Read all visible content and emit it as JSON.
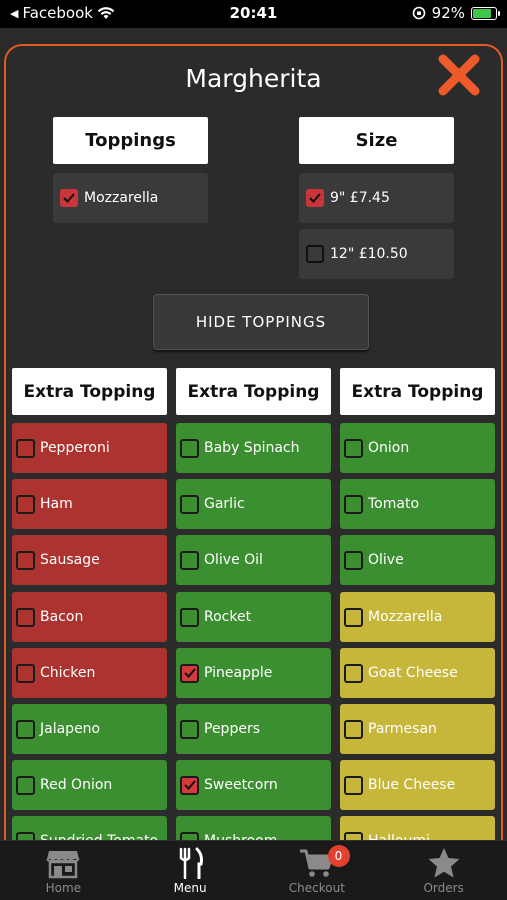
{
  "status_bar": {
    "back_app": "Facebook",
    "time": "20:41",
    "battery": "92%"
  },
  "modal": {
    "title": "Margherita",
    "toppings_header": "Toppings",
    "size_header": "Size",
    "base_toppings": [
      {
        "label": "Mozzarella",
        "checked": true
      }
    ],
    "sizes": [
      {
        "label": "9\" £7.45",
        "checked": true
      },
      {
        "label": "12\" £10.50",
        "checked": false
      }
    ],
    "hide_toppings_label": "HIDE TOPPINGS",
    "extra_header": "Extra Topping",
    "columns": [
      [
        {
          "label": "Pepperoni",
          "color": "red",
          "checked": false
        },
        {
          "label": "Ham",
          "color": "red",
          "checked": false
        },
        {
          "label": "Sausage",
          "color": "red",
          "checked": false
        },
        {
          "label": "Bacon",
          "color": "red",
          "checked": false
        },
        {
          "label": "Chicken",
          "color": "red",
          "checked": false
        },
        {
          "label": "Jalapeno",
          "color": "green",
          "checked": false
        },
        {
          "label": "Red Onion",
          "color": "green",
          "checked": false
        },
        {
          "label": "Sundried Tomato",
          "color": "green",
          "checked": false
        }
      ],
      [
        {
          "label": "Baby Spinach",
          "color": "green",
          "checked": false
        },
        {
          "label": "Garlic",
          "color": "green",
          "checked": false
        },
        {
          "label": "Olive Oil",
          "color": "green",
          "checked": false
        },
        {
          "label": "Rocket",
          "color": "green",
          "checked": false
        },
        {
          "label": "Pineapple",
          "color": "green",
          "checked": true
        },
        {
          "label": "Peppers",
          "color": "green",
          "checked": false
        },
        {
          "label": "Sweetcorn",
          "color": "green",
          "checked": true
        },
        {
          "label": "Mushroom",
          "color": "green",
          "checked": false
        }
      ],
      [
        {
          "label": "Onion",
          "color": "green",
          "checked": false
        },
        {
          "label": "Tomato",
          "color": "green",
          "checked": false
        },
        {
          "label": "Olive",
          "color": "green",
          "checked": false
        },
        {
          "label": "Mozzarella",
          "color": "yellow",
          "checked": false
        },
        {
          "label": "Goat Cheese",
          "color": "yellow",
          "checked": false
        },
        {
          "label": "Parmesan",
          "color": "yellow",
          "checked": false
        },
        {
          "label": "Blue Cheese",
          "color": "yellow",
          "checked": false
        },
        {
          "label": "Halloumi",
          "color": "yellow",
          "checked": false
        }
      ]
    ]
  },
  "tab_bar": {
    "tabs": [
      {
        "label": "Home",
        "icon": "store-icon",
        "active": false
      },
      {
        "label": "Menu",
        "icon": "fork-knife-icon",
        "active": true
      },
      {
        "label": "Checkout",
        "icon": "cart-icon",
        "active": false
      },
      {
        "label": "Orders",
        "icon": "star-icon",
        "active": false
      }
    ],
    "cart_badge": "0"
  },
  "colors": {
    "accent": "#e35a25",
    "red_tile": "#ad3330",
    "green_tile": "#3c8f30",
    "yellow_tile": "#c6b63a",
    "checkbox_checked": "#d33b3b"
  }
}
